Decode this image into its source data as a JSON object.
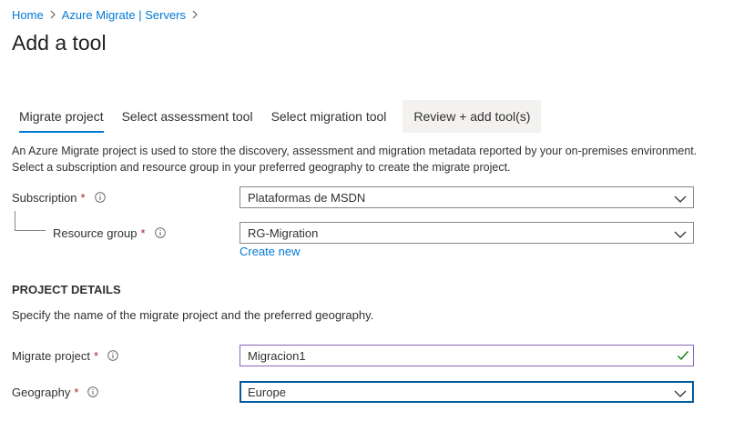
{
  "breadcrumb": {
    "home": "Home",
    "servers": "Azure Migrate | Servers"
  },
  "page": {
    "title": "Add a tool"
  },
  "tabs": [
    {
      "label": "Migrate project",
      "active": true
    },
    {
      "label": "Select assessment tool",
      "active": false
    },
    {
      "label": "Select migration tool",
      "active": false
    },
    {
      "label": "Review + add tool(s)",
      "active": false
    }
  ],
  "intro": {
    "text": "An Azure Migrate project is used to store the discovery, assessment and migration metadata reported by your on-premises environment. Select a subscription and resource group in your preferred geography to create the migrate project."
  },
  "subscription": {
    "label": "Subscription",
    "required_mark": "*",
    "value": "Plataformas de MSDN"
  },
  "resource_group": {
    "label": "Resource group",
    "required_mark": "*",
    "value": "RG-Migration",
    "create_new": "Create new"
  },
  "project_details": {
    "heading": "PROJECT DETAILS",
    "description": "Specify the name of the migrate project and the preferred geography."
  },
  "migrate_project": {
    "label": "Migrate project",
    "required_mark": "*",
    "value": "Migracion1"
  },
  "geography": {
    "label": "Geography",
    "required_mark": "*",
    "value": "Europe"
  },
  "colors": {
    "accent": "#0078d4",
    "required": "#a4262c",
    "valid_check": "#107c10",
    "valid_border": "#8764b8"
  }
}
